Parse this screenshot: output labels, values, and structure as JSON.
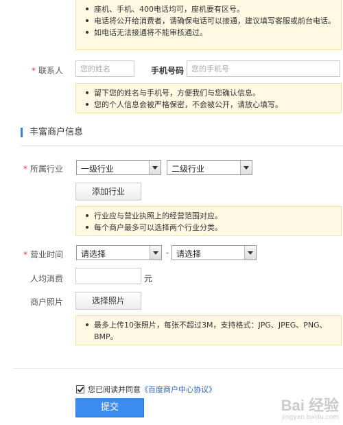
{
  "phone_tips": [
    "座机、手机、400电话均可，座机要有区号。",
    "电话将公开给消费者，请确保电话可以接通，建议填写客服或前台电话。",
    "如电话无法接通将不能审核通过。"
  ],
  "contact": {
    "required_mark": "*",
    "label": "联系人",
    "name_placeholder": "您的姓名",
    "phone_label": "手机号码",
    "phone_placeholder": "您的手机号"
  },
  "contact_tips": [
    "留下您的姓名与手机号，方便我们与您确认信息。",
    "您的个人信息会被严格保密，不会被公开，请放心填写。"
  ],
  "section": {
    "title": "丰富商户信息"
  },
  "industry": {
    "required_mark": "*",
    "label": "所属行业",
    "level1_selected": "一级行业",
    "level2_selected": "二级行业",
    "add_button": "添加行业"
  },
  "industry_tips": [
    "行业应与营业执照上的经营范围对应。",
    "每个商户最多可以选择两个行业分类。"
  ],
  "hours": {
    "required_mark": "*",
    "label": "营业时间",
    "start_selected": "请选择",
    "separator": "-",
    "end_selected": "请选择"
  },
  "avg_spend": {
    "label": "人均消费",
    "unit": "元",
    "value": ""
  },
  "photos": {
    "label": "商户照片",
    "button": "选择照片"
  },
  "photo_tips": [
    "最多上传10张照片，每张不超过3M，支持格式：JPG、JPEG、PNG、BMP。"
  ],
  "agreement": {
    "text": "您已阅读并同意",
    "link": "《百度商户中心协议》",
    "checked": true
  },
  "submit": {
    "label": "提交"
  },
  "watermark": {
    "main": "Bai 经验",
    "sub": "jingyan.baidu.com"
  },
  "colors": {
    "accent": "#3d8cf0",
    "required": "#e4393c",
    "tip_bg": "#fff8e3",
    "link": "#2a66c9"
  }
}
